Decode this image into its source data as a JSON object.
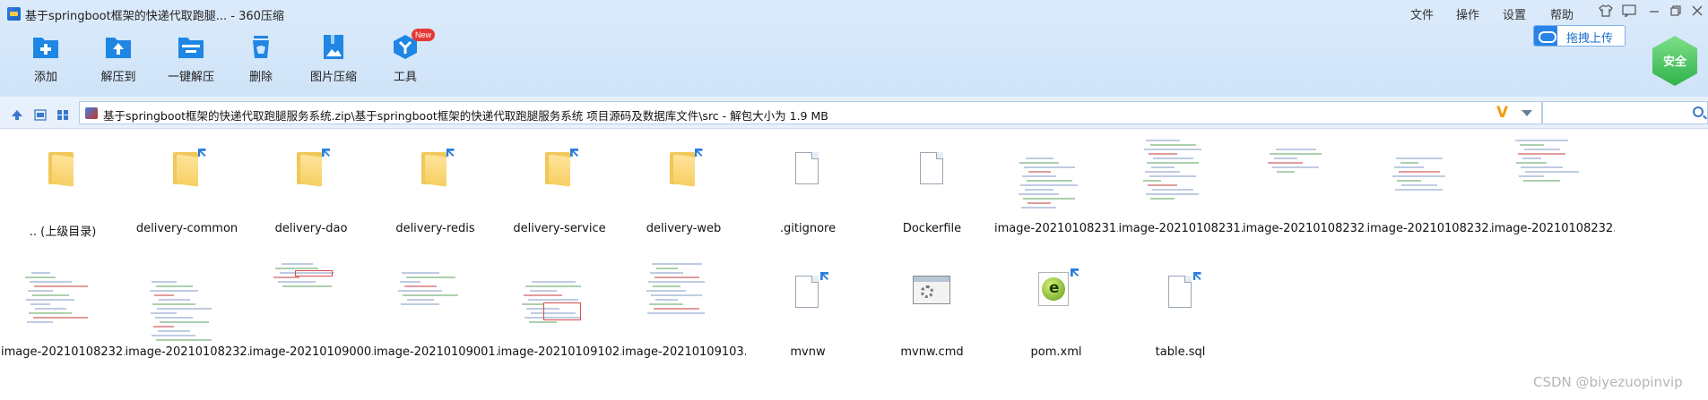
{
  "window": {
    "title": "基于springboot框架的快递代取跑腿... - 360压缩",
    "menu": [
      "文件",
      "操作",
      "设置",
      "帮助"
    ]
  },
  "toolbar": {
    "buttons": [
      {
        "label": "添加",
        "icon": "add-icon"
      },
      {
        "label": "解压到",
        "icon": "extract-to-icon"
      },
      {
        "label": "一键解压",
        "icon": "one-click-extract-icon"
      },
      {
        "label": "删除",
        "icon": "delete-icon"
      },
      {
        "label": "图片压缩",
        "icon": "image-compress-icon"
      },
      {
        "label": "工具",
        "icon": "tools-icon",
        "badge": "New"
      }
    ],
    "upload_label": "拖拽上传",
    "safe_label": "安全"
  },
  "address": {
    "path": "基于springboot框架的快递代取跑腿服务系统.zip\\基于springboot框架的快递代取跑腿服务系统 项目源码及数据库文件\\src - 解包大小为 1.9 MB",
    "search_placeholder": ""
  },
  "files": [
    {
      "name": ".. (上级目录)",
      "type": "parent-folder"
    },
    {
      "name": "delivery-common",
      "type": "folder"
    },
    {
      "name": "delivery-dao",
      "type": "folder"
    },
    {
      "name": "delivery-redis",
      "type": "folder"
    },
    {
      "name": "delivery-service",
      "type": "folder"
    },
    {
      "name": "delivery-web",
      "type": "folder"
    },
    {
      "name": ".gitignore",
      "type": "file"
    },
    {
      "name": "Dockerfile",
      "type": "file"
    },
    {
      "name": "image-20210108231...",
      "type": "image"
    },
    {
      "name": "image-20210108231...",
      "type": "image"
    },
    {
      "name": "image-20210108232...",
      "type": "image"
    },
    {
      "name": "image-20210108232...",
      "type": "image"
    },
    {
      "name": "image-20210108232...",
      "type": "image"
    },
    {
      "name": "image-20210108232...",
      "type": "image"
    },
    {
      "name": "image-20210108232...",
      "type": "image"
    },
    {
      "name": "image-20210109000...",
      "type": "image"
    },
    {
      "name": "image-20210109001...",
      "type": "image"
    },
    {
      "name": "image-20210109102...",
      "type": "image"
    },
    {
      "name": "image-20210109103...",
      "type": "image"
    },
    {
      "name": "mvnw",
      "type": "file"
    },
    {
      "name": "mvnw.cmd",
      "type": "cmd"
    },
    {
      "name": "pom.xml",
      "type": "xml"
    },
    {
      "name": "table.sql",
      "type": "file"
    }
  ],
  "watermark": "CSDN @biyezuopinvip",
  "colors": {
    "accent": "#2a7fde",
    "folder": "#f6cf62",
    "toolbar_bg": "#dcebfb"
  }
}
